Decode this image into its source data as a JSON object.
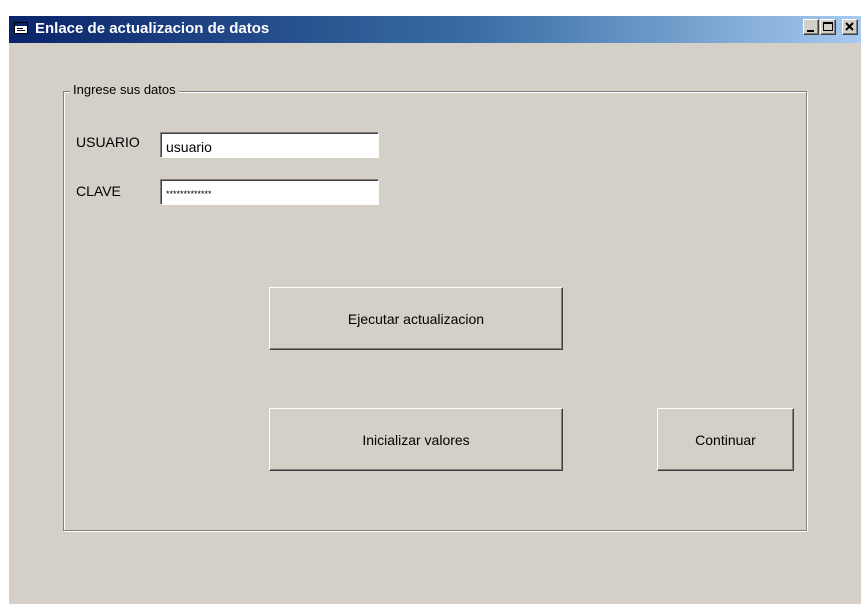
{
  "window": {
    "title": "Enlace de actualizacion de datos",
    "icons": [
      "app-form-icon",
      "minimize-icon",
      "maximize-icon",
      "close-icon"
    ],
    "colors": {
      "titlebar_start": "#0a246a",
      "titlebar_end": "#a6caf0",
      "face": "#d4d0c8"
    }
  },
  "form": {
    "group_label": "Ingrese sus datos",
    "usuario_label": "USUARIO",
    "usuario_value": "usuario",
    "clave_label": "CLAVE",
    "clave_value": "*************",
    "buttons": {
      "execute": "Ejecutar actualizacion",
      "reset": "Inicializar valores",
      "continue": "Continuar"
    }
  }
}
